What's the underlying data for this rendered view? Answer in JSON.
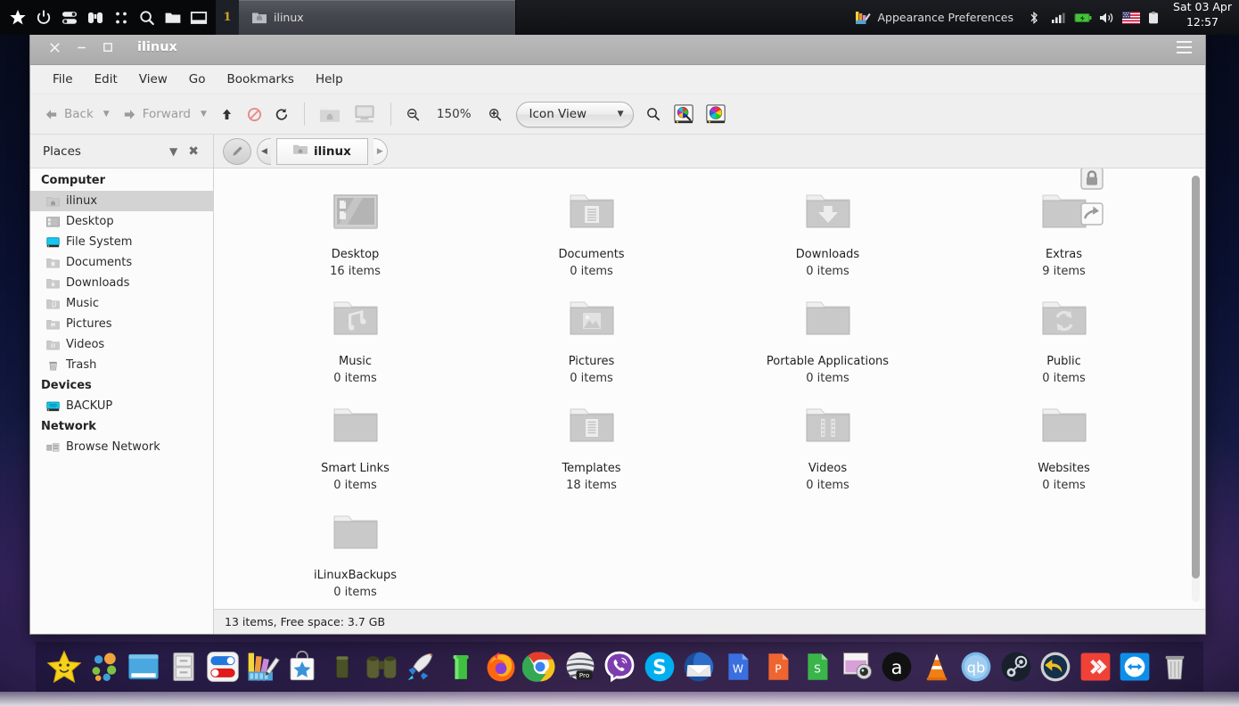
{
  "panel": {
    "launchers": [
      {
        "name": "menu-star-icon",
        "icon": "star"
      },
      {
        "name": "power-icon",
        "icon": "power"
      },
      {
        "name": "settings-toggle-icon",
        "icon": "toggles"
      },
      {
        "name": "binoculars-icon",
        "icon": "binoculars"
      },
      {
        "name": "apps-grid-icon",
        "icon": "dots"
      },
      {
        "name": "search-icon",
        "icon": "search"
      },
      {
        "name": "file-manager-icon",
        "icon": "folder"
      },
      {
        "name": "show-desktop-icon",
        "icon": "window"
      }
    ],
    "workspace": "1",
    "tasks": [
      {
        "label": "ilinux",
        "icon": "home-folder",
        "active": true
      },
      {
        "label": "Appearance Preferences",
        "icon": "appearance",
        "active": false
      }
    ],
    "tray": [
      "bluetooth-icon",
      "signal-icon",
      "battery-icon",
      "volume-icon",
      "keyboard-flag-icon",
      "clipboard-icon"
    ],
    "clock": {
      "date": "Sat 03 Apr",
      "time": "12:57"
    }
  },
  "window": {
    "title": "ilinux",
    "controls": {
      "close": "✕",
      "minimize": "–",
      "maximize": "□"
    },
    "menu_button": "hamburger-menu",
    "menubar": [
      "File",
      "Edit",
      "View",
      "Go",
      "Bookmarks",
      "Help"
    ]
  },
  "toolbar": {
    "back_label": "Back",
    "forward_label": "Forward",
    "up_label": "up-icon",
    "stop_label": "stop-icon",
    "reload_label": "reload-icon",
    "home_label": "home-icon",
    "computer_label": "computer-icon",
    "zoom_out_label": "zoom-out-icon",
    "zoom_level": "150%",
    "zoom_in_label": "zoom-in-icon",
    "view_mode": "Icon View",
    "search_label": "search-icon",
    "extra_buttons": [
      "color-picker-magnifier-icon",
      "color-wheel-icon"
    ]
  },
  "sidebar": {
    "header": "Places",
    "groups": [
      {
        "title": "Computer",
        "items": [
          {
            "label": "ilinux",
            "icon": "home-folder-icon",
            "selected": true
          },
          {
            "label": "Desktop",
            "icon": "desktop-icon",
            "selected": false
          },
          {
            "label": "File System",
            "icon": "drive-icon",
            "selected": false
          },
          {
            "label": "Documents",
            "icon": "documents-folder-icon",
            "selected": false
          },
          {
            "label": "Downloads",
            "icon": "downloads-folder-icon",
            "selected": false
          },
          {
            "label": "Music",
            "icon": "music-folder-icon",
            "selected": false
          },
          {
            "label": "Pictures",
            "icon": "pictures-folder-icon",
            "selected": false
          },
          {
            "label": "Videos",
            "icon": "videos-folder-icon",
            "selected": false
          },
          {
            "label": "Trash",
            "icon": "trash-icon",
            "selected": false
          }
        ]
      },
      {
        "title": "Devices",
        "items": [
          {
            "label": "BACKUP",
            "icon": "ssd-drive-icon",
            "selected": false
          }
        ]
      },
      {
        "title": "Network",
        "items": [
          {
            "label": "Browse Network",
            "icon": "network-icon",
            "selected": false
          }
        ]
      }
    ]
  },
  "pathbar": {
    "edit_button": "edit-path-icon",
    "prev_button": "◂",
    "next_button": "▸",
    "crumbs": [
      {
        "label": "ilinux",
        "icon": "home-folder-icon"
      }
    ]
  },
  "files": [
    {
      "name": "Desktop",
      "count": "16 items",
      "icon": "desktop-icon",
      "emblems": []
    },
    {
      "name": "Documents",
      "count": "0 items",
      "icon": "documents-folder",
      "emblems": []
    },
    {
      "name": "Downloads",
      "count": "0 items",
      "icon": "downloads-folder",
      "emblems": []
    },
    {
      "name": "Extras",
      "count": "9 items",
      "icon": "plain-folder",
      "emblems": [
        "lock-emblem",
        "symlink-emblem"
      ]
    },
    {
      "name": "Music",
      "count": "0 items",
      "icon": "music-folder",
      "emblems": []
    },
    {
      "name": "Pictures",
      "count": "0 items",
      "icon": "pictures-folder",
      "emblems": []
    },
    {
      "name": "Portable Applications",
      "count": "0 items",
      "icon": "plain-folder",
      "emblems": []
    },
    {
      "name": "Public",
      "count": "0 items",
      "icon": "public-folder",
      "emblems": []
    },
    {
      "name": "Smart Links",
      "count": "0 items",
      "icon": "plain-folder",
      "emblems": []
    },
    {
      "name": "Templates",
      "count": "18 items",
      "icon": "templates-folder",
      "emblems": []
    },
    {
      "name": "Videos",
      "count": "0 items",
      "icon": "videos-folder",
      "emblems": []
    },
    {
      "name": "Websites",
      "count": "0 items",
      "icon": "plain-folder",
      "emblems": []
    },
    {
      "name": "iLinuxBackups",
      "count": "0 items",
      "icon": "plain-folder",
      "emblems": []
    }
  ],
  "statusbar": {
    "text": "13 items, Free space: 3.7 GB"
  },
  "dock": {
    "items": [
      {
        "name": "menu-star-launcher",
        "icon": "star-smiley"
      },
      {
        "name": "app-finder-launcher",
        "icon": "color-dots"
      },
      {
        "name": "window-manager-launcher",
        "icon": "blue-window"
      },
      {
        "name": "file-cabinet-launcher",
        "icon": "file-cabinet"
      },
      {
        "name": "settings-launcher",
        "icon": "toggles"
      },
      {
        "name": "appearance-launcher",
        "icon": "color-swatches"
      },
      {
        "name": "software-center-launcher",
        "icon": "star-bag"
      },
      {
        "name": "terminal-launcher",
        "icon": "dark-cylinder"
      },
      {
        "name": "search-launcher",
        "icon": "binoculars"
      },
      {
        "name": "rocket-launcher",
        "icon": "rocket"
      },
      {
        "name": "pipe-launcher",
        "icon": "green-pipe"
      },
      {
        "name": "firefox-launcher",
        "icon": "firefox"
      },
      {
        "name": "chrome-launcher",
        "icon": "chrome"
      },
      {
        "name": "opera-launcher",
        "icon": "opera-pro"
      },
      {
        "name": "viber-launcher",
        "icon": "viber"
      },
      {
        "name": "skype-launcher",
        "icon": "skype"
      },
      {
        "name": "thunderbird-launcher",
        "icon": "thunderbird"
      },
      {
        "name": "writer-launcher",
        "icon": "w-doc"
      },
      {
        "name": "impress-launcher",
        "icon": "p-doc"
      },
      {
        "name": "calc-launcher",
        "icon": "s-doc"
      },
      {
        "name": "screenshot-launcher",
        "icon": "screenshot"
      },
      {
        "name": "amazon-launcher",
        "icon": "amazon-a"
      },
      {
        "name": "vlc-launcher",
        "icon": "vlc-cone"
      },
      {
        "name": "qbittorrent-launcher",
        "icon": "qbittorrent"
      },
      {
        "name": "steam-launcher",
        "icon": "steam"
      },
      {
        "name": "backup-restore-launcher",
        "icon": "undo-arrow"
      },
      {
        "name": "anydesk-launcher",
        "icon": "anydesk"
      },
      {
        "name": "teamviewer-launcher",
        "icon": "teamviewer"
      },
      {
        "name": "trash-launcher",
        "icon": "trash-can"
      }
    ]
  },
  "colors": {
    "accent": "#3a7fd5",
    "titlebar": "#b4b4b4",
    "panel": "#15171b",
    "selection": "#d3d3d3"
  }
}
